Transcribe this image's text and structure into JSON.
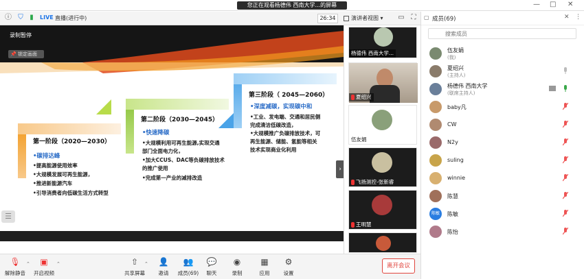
{
  "window": {
    "title": "您正在观看杨德伟 西南大学...的屏幕",
    "controls": [
      "—",
      "□",
      "✕"
    ]
  },
  "top_toolbar": {
    "live_badge": "LIVE",
    "live_status": "直播(进行中)",
    "timer": "26:34",
    "view_label": "演讲者视图"
  },
  "shared_screen": {
    "recording_label": "录制暂停",
    "lock_label": "锁定画面",
    "stages": [
      {
        "title": "第一阶段（2020—2030）",
        "subtitle": "•碳排达峰",
        "lines": [
          "•提高能源使用效率",
          "•大规模发展可再生能源，",
          "•推进新能源汽车",
          "•引导消费者向低碳生活方式转型"
        ]
      },
      {
        "title": "第二阶段（2030—2045）",
        "subtitle": "•快速降碳",
        "lines": [
          "•大规模利用可再生能源,实现交通",
          "部门全面电力化，",
          "•加大CCUS、DAC等负碳排放技术",
          "的推广使用",
          "•完成第一产业的减排改造"
        ]
      },
      {
        "title": "第三阶段（ 2045—2060）",
        "subtitle": "•深度减碳，实现碳中和",
        "lines": [
          "•工业、发电端、交通和居民侧",
          "完成清洁低碳改造，",
          "•大规模推广负碳排放技术，可",
          "再生能源、储能、氢能等相关",
          "技术实现商业化利用"
        ]
      }
    ]
  },
  "video_strip": [
    {
      "name": "杨德伟 西南大学...",
      "style": "avatar-bar"
    },
    {
      "name": "夏绍兴",
      "style": "photo"
    },
    {
      "name": "伍友娟",
      "style": "avatar-plain"
    },
    {
      "name": "飞扬测控-张新睿",
      "style": "avatar-dark"
    },
    {
      "name": "王明慧",
      "style": "avatar-dark"
    },
    {
      "name": "",
      "style": "avatar-dark"
    }
  ],
  "bottom_toolbar": {
    "items": [
      "解除静音",
      "开启视频",
      "共享屏幕",
      "邀请",
      "成员(69)",
      "聊天",
      "录制",
      "应用",
      "设置"
    ],
    "leave_label": "离开会议"
  },
  "members_panel": {
    "title": "成员(69)",
    "search_placeholder": "搜索成员",
    "members": [
      {
        "name": "伍友娟",
        "role": "(我)",
        "mic": "none",
        "color": "#7a8a70"
      },
      {
        "name": "夏绍兴",
        "role": "(主持人)",
        "mic": "grey",
        "color": "#8a7b6a"
      },
      {
        "name": "杨德伟 西南大学",
        "role": "(联席主持人)",
        "mic": "green",
        "color": "#6a7f9a"
      },
      {
        "name": "baby凡",
        "role": "",
        "mic": "muted",
        "color": "#c89a6a"
      },
      {
        "name": "CW",
        "role": "",
        "mic": "muted",
        "color": "#b08a70"
      },
      {
        "name": "N2y",
        "role": "",
        "mic": "muted",
        "color": "#9a6a6a"
      },
      {
        "name": "suling",
        "role": "",
        "mic": "muted",
        "color": "#c8a44a"
      },
      {
        "name": "winnie",
        "role": "",
        "mic": "muted",
        "color": "#d8b070"
      },
      {
        "name": "陈慧",
        "role": "",
        "mic": "muted",
        "color": "#a0705a"
      },
      {
        "name": "陈敏",
        "role": "",
        "mic": "muted",
        "color": "#2a7de1",
        "initials": "陈敏"
      },
      {
        "name": "陈怡",
        "role": "",
        "mic": "muted",
        "color": "#b07a8a"
      }
    ]
  }
}
